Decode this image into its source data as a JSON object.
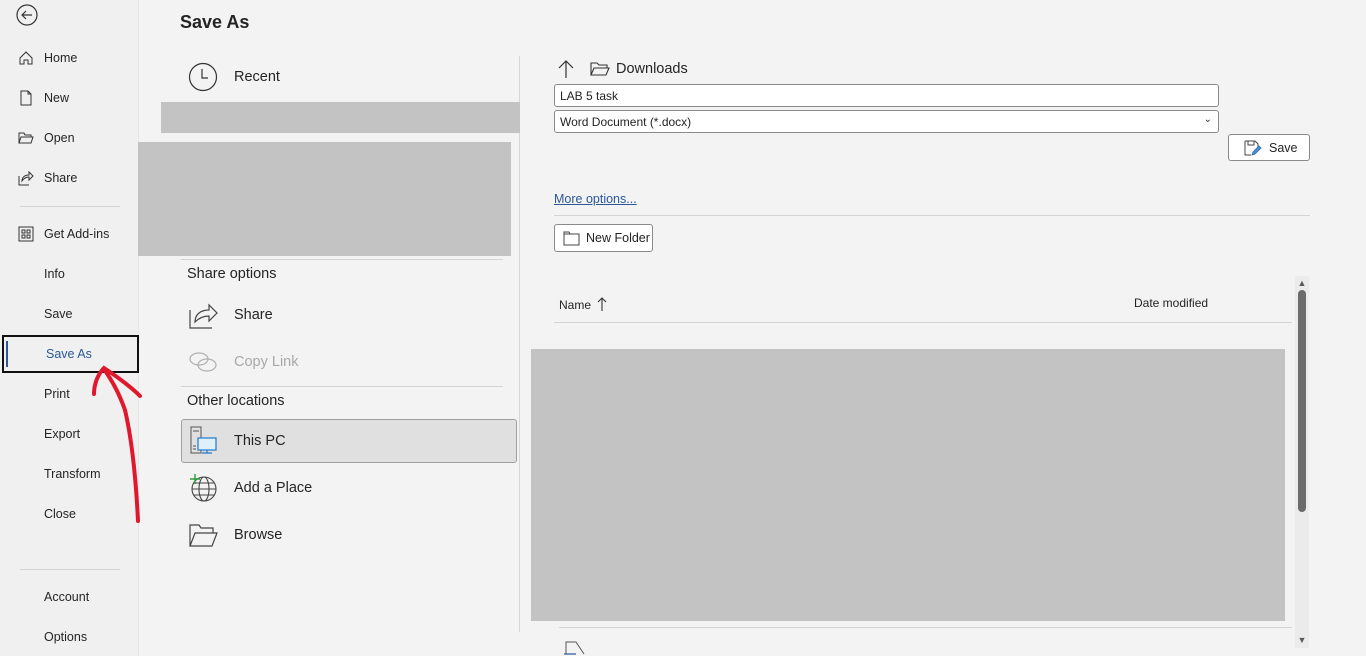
{
  "nav": {
    "back_label": "Back",
    "items": [
      {
        "label": "Home",
        "icon": "home-icon"
      },
      {
        "label": "New",
        "icon": "new-document-icon"
      },
      {
        "label": "Open",
        "icon": "open-folder-icon"
      },
      {
        "label": "Share",
        "icon": "share-icon"
      },
      {
        "label": "Get Add-ins",
        "icon": "add-ins-icon"
      },
      {
        "label": "Info"
      },
      {
        "label": "Save"
      },
      {
        "label": "Save As",
        "active": true
      },
      {
        "label": "Print"
      },
      {
        "label": "Export"
      },
      {
        "label": "Transform"
      },
      {
        "label": "Close"
      },
      {
        "label": "Account"
      },
      {
        "label": "Options"
      }
    ]
  },
  "page_title": "Save As",
  "locations": {
    "recent_label": "Recent",
    "share_options_heading": "Share options",
    "share_label": "Share",
    "copy_link_label": "Copy Link",
    "other_locations_heading": "Other locations",
    "this_pc_label": "This PC",
    "add_place_label": "Add a Place",
    "browse_label": "Browse"
  },
  "save_panel": {
    "current_folder": "Downloads",
    "file_name": "LAB 5 task",
    "file_type": "Word Document (*.docx)",
    "save_label": "Save",
    "more_options_label": "More options...",
    "new_folder_label": "New Folder",
    "columns": {
      "name": "Name",
      "date_modified": "Date modified"
    },
    "sort": "name-ascending"
  },
  "colors": {
    "accent": "#2b579a",
    "annotation": "#e0182d",
    "redaction": "#c3c3c3"
  }
}
